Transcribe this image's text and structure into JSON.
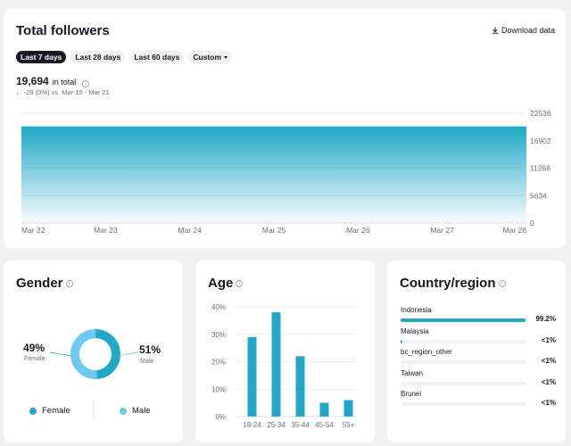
{
  "followers": {
    "title": "Total followers",
    "download_label": "Download data",
    "ranges": [
      {
        "label": "Last 7 days",
        "active": true
      },
      {
        "label": "Last 28 days",
        "active": false
      },
      {
        "label": "Last 60 days",
        "active": false
      },
      {
        "label": "Custom",
        "active": false
      }
    ],
    "total": "19,694",
    "total_suffix": "in total",
    "change": "-29 (0%) vs. Mar 15 - Mar 21",
    "down_arrow": "↓",
    "download_icon": "download-icon",
    "color": "#20a8c6"
  },
  "gender": {
    "title": "Gender",
    "female_pct": "49%",
    "female_label": "Female",
    "male_pct": "51%",
    "male_label": "Male",
    "legend_female": "Female",
    "legend_male": "Male",
    "female_color": "#20a8c6",
    "male_color": "#6dc9f0"
  },
  "age": {
    "title": "Age"
  },
  "country": {
    "title": "Country/region",
    "rows": [
      {
        "name": "Indonesia",
        "pct": "99.2%",
        "value": 0.992
      },
      {
        "name": "Malaysia",
        "pct": "<1%",
        "value": 0.005
      },
      {
        "name": "bc_region_other",
        "pct": "<1%",
        "value": 0.0
      },
      {
        "name": "Taiwan",
        "pct": "<1%",
        "value": 0.0
      },
      {
        "name": "Brunei",
        "pct": "<1%",
        "value": 0.0
      }
    ]
  },
  "chart_data": [
    {
      "type": "area",
      "x": [
        "Mar 22",
        "Mar 23",
        "Mar 24",
        "Mar 25",
        "Mar 26",
        "Mar 27",
        "Mar 28"
      ],
      "values": [
        19694,
        19694,
        19694,
        19694,
        19694,
        19694,
        19694
      ],
      "y_ticks": [
        "22536",
        "16902",
        "11268",
        "5634",
        "0"
      ],
      "ylim": [
        0,
        22536
      ],
      "grid": true,
      "color": "#20a8c6"
    },
    {
      "type": "pie",
      "labels": [
        "Female",
        "Male"
      ],
      "values": [
        49,
        51
      ],
      "colors": [
        "#20a8c6",
        "#6dc9f0"
      ]
    },
    {
      "type": "bar",
      "categories": [
        "18-24",
        "25-34",
        "35-44",
        "45-54",
        "55+"
      ],
      "values": [
        29,
        38,
        22,
        5,
        6
      ],
      "y_ticks": [
        "40%",
        "30%",
        "20%",
        "10%",
        "0%"
      ],
      "ylim": [
        0,
        40
      ],
      "grid": true,
      "color": "#20a8c6"
    }
  ]
}
